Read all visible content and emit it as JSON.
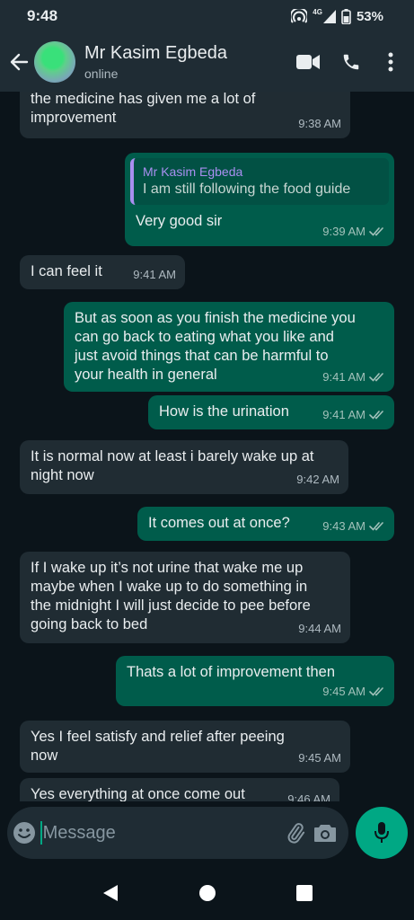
{
  "status_bar": {
    "time": "9:48",
    "network": "4G",
    "battery": "53%"
  },
  "header": {
    "contact_name": "Mr Kasim Egbeda",
    "contact_status": "online",
    "icons": [
      "back-arrow-icon",
      "video-call-icon",
      "phone-icon",
      "more-vert-icon"
    ]
  },
  "messages": [
    {
      "dir": "in",
      "text": "the medicine has given me a lot of\nimprovement",
      "time": "9:38 AM"
    },
    {
      "dir": "out",
      "quote_name": "Mr Kasim Egbeda",
      "quote_text": "I am still following the food guide",
      "text": "Very good sir",
      "time": "9:39 AM"
    },
    {
      "dir": "in",
      "text": "I can feel it",
      "time": "9:41 AM"
    },
    {
      "dir": "out",
      "text": "But as soon as you finish the medicine you\ncan go back to eating what you like and\njust avoid things that can be harmful to\nyour health in general",
      "time": "9:41 AM"
    },
    {
      "dir": "out",
      "text": "How is the urination",
      "time": "9:41 AM"
    },
    {
      "dir": "in",
      "text": "It is normal now at least i barely wake up at\nnight now",
      "time": "9:42 AM"
    },
    {
      "dir": "out",
      "text": "It comes out at once?",
      "time": "9:43 AM"
    },
    {
      "dir": "in",
      "text": "If I wake up it’s not urine that wake me up\nmaybe when I wake up to do something in\nthe midnight I will just decide to pee before\ngoing back to bed",
      "time": "9:44 AM"
    },
    {
      "dir": "out",
      "text": "Thats a lot of improvement then",
      "time": "9:45 AM"
    },
    {
      "dir": "in",
      "text": "Yes I feel satisfy and relief after peeing\nnow",
      "time": "9:45 AM"
    },
    {
      "dir": "in",
      "text": "Yes everything at once come out",
      "time": "9:46 AM"
    }
  ],
  "input": {
    "placeholder": "Message"
  },
  "colors": {
    "background": "#0b141a",
    "bar": "#1f2c34",
    "incoming_bubble": "#202c33",
    "outgoing_bubble": "#005c4b",
    "accent": "#00a884",
    "quote_accent": "#a98ff0"
  }
}
